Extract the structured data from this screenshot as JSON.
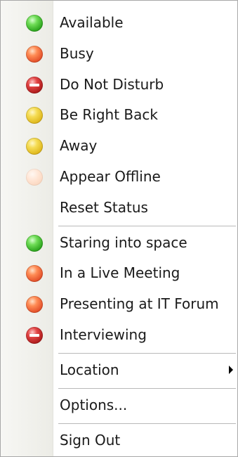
{
  "menu": {
    "status_items": [
      {
        "label": "Available",
        "icon": "available-status-icon",
        "color": "#2ea71f"
      },
      {
        "label": "Busy",
        "icon": "busy-status-icon",
        "color": "#e5522b"
      },
      {
        "label": "Do Not Disturb",
        "icon": "do-not-disturb-status-icon",
        "color": "#b11e1e"
      },
      {
        "label": "Be Right Back",
        "icon": "be-right-back-status-icon",
        "color": "#e0b91e"
      },
      {
        "label": "Away",
        "icon": "away-status-icon",
        "color": "#e0b91e"
      },
      {
        "label": "Appear Offline",
        "icon": "appear-offline-status-icon",
        "color": "#f6cdb3"
      }
    ],
    "reset_status_label": "Reset Status",
    "custom_items": [
      {
        "label": "Staring into space",
        "icon": "available-status-icon",
        "color": "#2ea71f"
      },
      {
        "label": "In a Live Meeting",
        "icon": "busy-status-icon",
        "color": "#e5522b"
      },
      {
        "label": "Presenting at IT Forum",
        "icon": "busy-status-icon",
        "color": "#e5522b"
      },
      {
        "label": "Interviewing",
        "icon": "do-not-disturb-status-icon",
        "color": "#b11e1e"
      }
    ],
    "location_label": "Location",
    "options_label": "Options...",
    "sign_out_label": "Sign Out"
  }
}
